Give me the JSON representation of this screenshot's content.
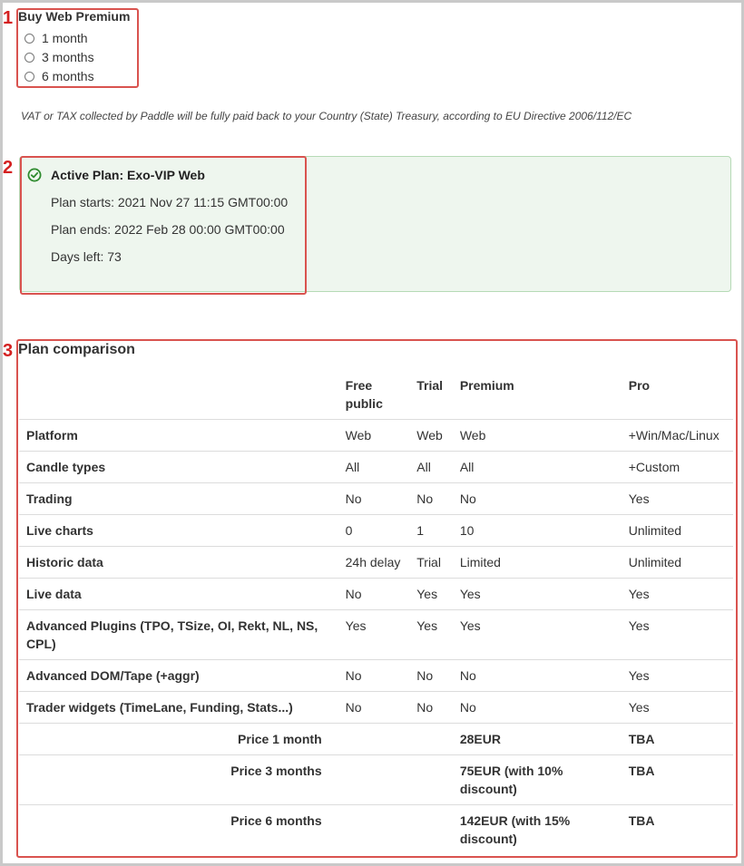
{
  "markers": [
    "1",
    "2",
    "3"
  ],
  "buy": {
    "title": "Buy Web Premium",
    "options": [
      "1 month",
      "3 months",
      "6 months"
    ]
  },
  "vat_note": "VAT or TAX collected by Paddle will be fully paid back to your Country (State) Treasury, according to EU Directive 2006/112/EC",
  "active_plan": {
    "title": "Active Plan: Exo-VIP Web",
    "starts": "Plan starts: 2021 Nov 27 11:15 GMT00:00",
    "ends": "Plan ends: 2022 Feb 28 00:00 GMT00:00",
    "days_left": "Days left: 73",
    "icon": "check-circle-icon",
    "accent_color": "#2e8b2e"
  },
  "comparison": {
    "title": "Plan comparison",
    "headers": [
      "",
      "Free public",
      "Trial",
      "Premium",
      "Pro"
    ],
    "rows": [
      [
        "Platform",
        "Web",
        "Web",
        "Web",
        "+Win/Mac/Linux"
      ],
      [
        "Candle types",
        "All",
        "All",
        "All",
        "+Custom"
      ],
      [
        "Trading",
        "No",
        "No",
        "No",
        "Yes"
      ],
      [
        "Live charts",
        "0",
        "1",
        "10",
        "Unlimited"
      ],
      [
        "Historic data",
        "24h delay",
        "Trial",
        "Limited",
        "Unlimited"
      ],
      [
        "Live data",
        "No",
        "Yes",
        "Yes",
        "Yes"
      ],
      [
        "Advanced Plugins (TPO, TSize, OI, Rekt, NL, NS, CPL)",
        "Yes",
        "Yes",
        "Yes",
        "Yes"
      ],
      [
        "Advanced DOM/Tape (+aggr)",
        "No",
        "No",
        "No",
        "Yes"
      ],
      [
        "Trader widgets (TimeLane, Funding, Stats...)",
        "No",
        "No",
        "No",
        "Yes"
      ]
    ],
    "prices": [
      [
        "Price 1 month",
        "28EUR",
        "TBA"
      ],
      [
        "Price 3 months",
        "75EUR (with 10% discount)",
        "TBA"
      ],
      [
        "Price 6 months",
        "142EUR (with 15% discount)",
        "TBA"
      ]
    ]
  }
}
